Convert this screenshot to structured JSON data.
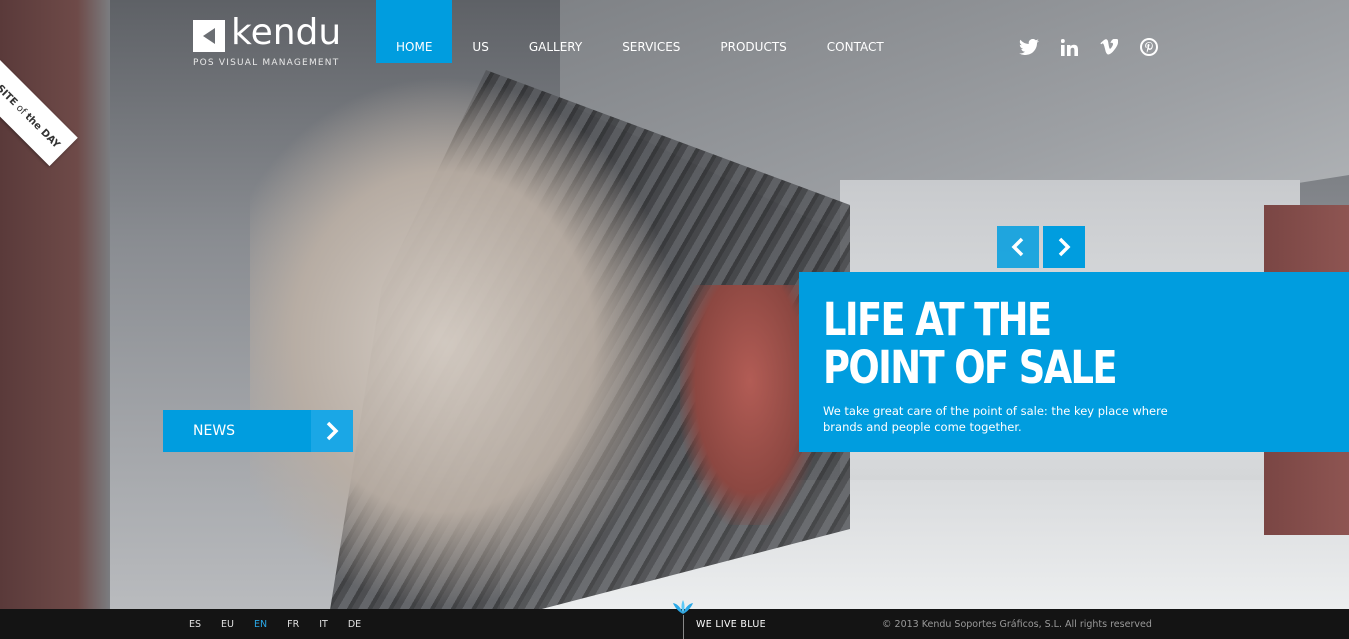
{
  "brand": {
    "name": "kendu",
    "tagline": "POS VISUAL MANAGEMENT"
  },
  "nav": {
    "items": [
      {
        "label": "HOME",
        "active": true
      },
      {
        "label": "US",
        "active": false
      },
      {
        "label": "GALLERY",
        "active": false
      },
      {
        "label": "SERVICES",
        "active": false
      },
      {
        "label": "PRODUCTS",
        "active": false
      },
      {
        "label": "CONTACT",
        "active": false
      }
    ]
  },
  "social": {
    "icons": [
      "twitter-icon",
      "linkedin-icon",
      "vimeo-icon",
      "pinterest-icon"
    ]
  },
  "badge": {
    "line1": "SITE",
    "line2": "of",
    "line3": "the DAY"
  },
  "slide": {
    "title": "LIFE AT THE POINT OF SALE",
    "text": "We take great care of the point of sale: the key place where brands and people come together."
  },
  "news": {
    "label": "NEWS"
  },
  "footer": {
    "languages": [
      {
        "code": "ES",
        "active": false
      },
      {
        "code": "EU",
        "active": false
      },
      {
        "code": "EN",
        "active": true
      },
      {
        "code": "FR",
        "active": false
      },
      {
        "code": "IT",
        "active": false
      },
      {
        "code": "DE",
        "active": false
      }
    ],
    "slogan": "WE LIVE BLUE",
    "copyright": "© 2013 Kendu Soportes Gráficos, S.L. All rights reserved"
  },
  "colors": {
    "accent": "#009ddf",
    "footer_bg": "#141414"
  }
}
